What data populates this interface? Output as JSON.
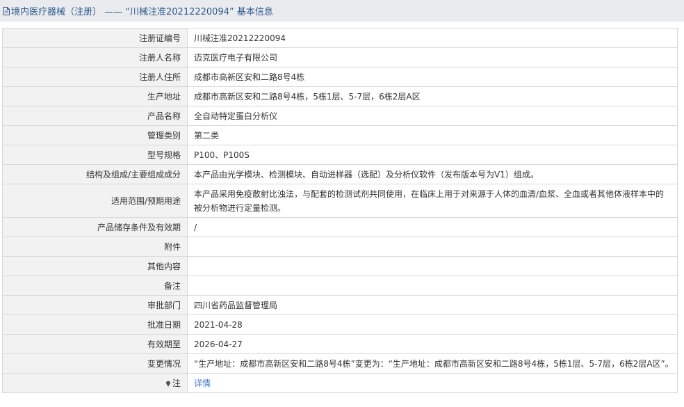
{
  "header": {
    "title": "境内医疗器械（注册） —— “川械注准20212220094” 基本信息",
    "icon": "document-icon"
  },
  "rows": [
    {
      "label": "注册证编号",
      "value": "川械注准20212220094"
    },
    {
      "label": "注册人名称",
      "value": "迈克医疗电子有限公司"
    },
    {
      "label": "注册人住所",
      "value": "成都市高新区安和二路8号4栋"
    },
    {
      "label": "生产地址",
      "value": "成都市高新区安和二路8号4栋，5栋1层、5-7层，6栋2层A区"
    },
    {
      "label": "产品名称",
      "value": "全自动特定蛋白分析仪"
    },
    {
      "label": "管理类别",
      "value": "第二类"
    },
    {
      "label": "型号规格",
      "value": "P100、P100S"
    },
    {
      "label": "结构及组成/主要组成成分",
      "value": "本产品由光学模块、检测模块、自动进样器（选配）及分析仪软件（发布版本号为V1）组成。"
    },
    {
      "label": "适用范围/预期用途",
      "value": "本产品采用免疫散射比浊法，与配套的检测试剂共同使用，在临床上用于对来源于人体的血清/血浆、全血或者其他体液样本中的被分析物进行定量检测。"
    },
    {
      "label": "产品储存条件及有效期",
      "value": "/"
    },
    {
      "label": "附件",
      "value": ""
    },
    {
      "label": "其他内容",
      "value": ""
    },
    {
      "label": "备注",
      "value": ""
    },
    {
      "label": "审批部门",
      "value": "四川省药品监督管理局"
    },
    {
      "label": "批准日期",
      "value": "2021-04-28"
    },
    {
      "label": "有效期至",
      "value": "2026-04-27"
    },
    {
      "label": "变更情况",
      "value": "“生产地址：成都市高新区安和二路8号4栋”变更为：“生产地址：成都市高新区安和二路8号4栋，5栋1层、5-7层，6栋2层A区”。"
    }
  ],
  "note": {
    "label": "注",
    "icon": "pin-icon",
    "link_text": "详情"
  },
  "colors": {
    "title_bar_bg": "#e9ebee",
    "title_text": "#2f5a8c",
    "label_bg": "#f2f2f2",
    "link": "#3b71c9",
    "border": "#d8d8d8"
  }
}
